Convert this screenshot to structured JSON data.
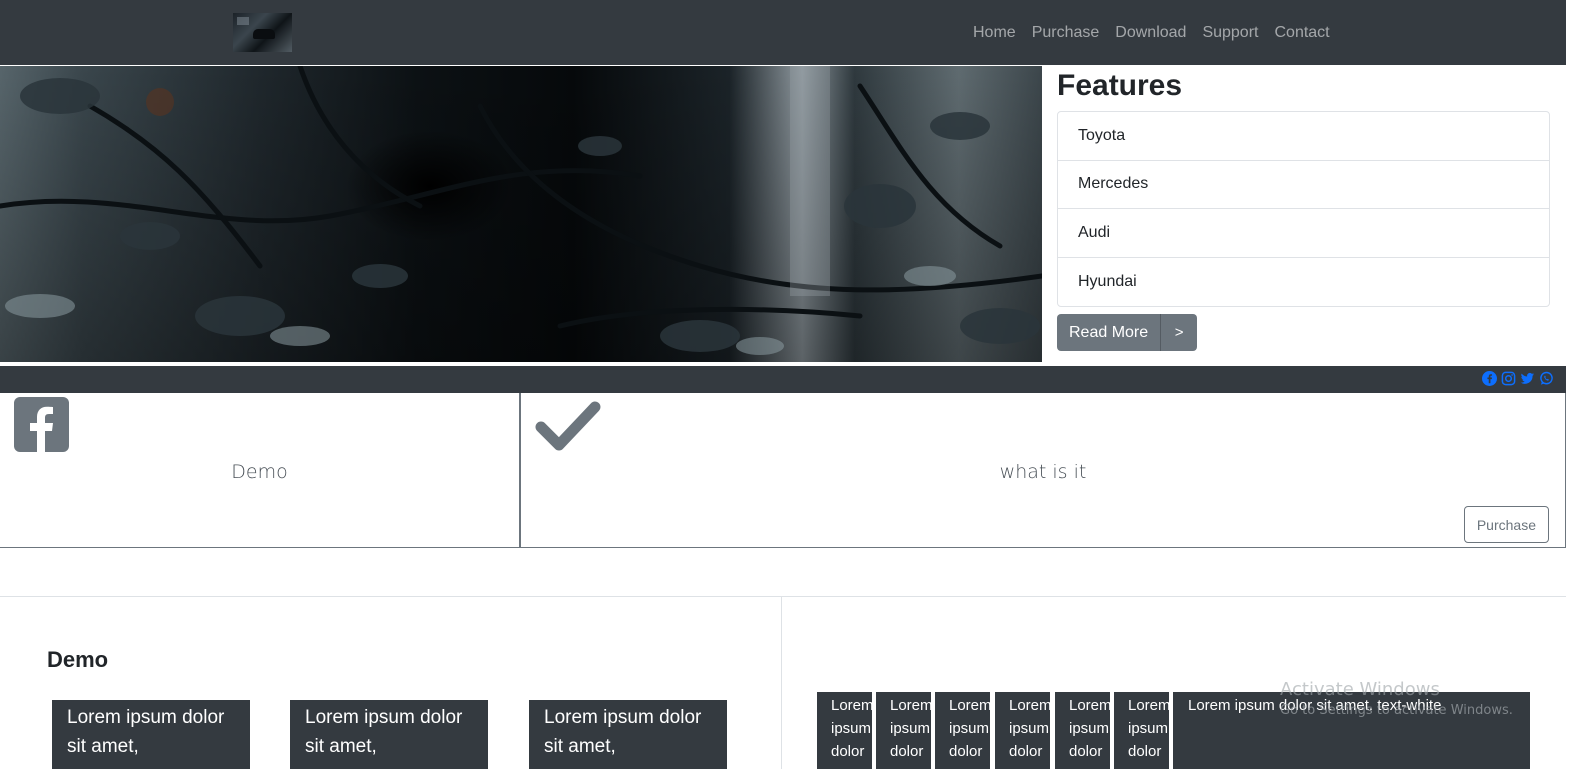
{
  "navbar": {
    "links": [
      "Home",
      "Purchase",
      "Download",
      "Support",
      "Contact"
    ]
  },
  "features": {
    "title": "Features",
    "items": [
      "Toyota",
      "Mercedes",
      "Audi",
      "Hyundai"
    ],
    "read_more_label": "Read More",
    "next_label": ">"
  },
  "social": {
    "icons": [
      "facebook-icon",
      "instagram-icon",
      "twitter-icon",
      "whatsapp-icon"
    ],
    "color": "#0d6efd"
  },
  "cards": {
    "left_text": "Demo",
    "right_text": "what is it",
    "purchase_label": "Purchase"
  },
  "demo": {
    "heading": "Demo",
    "cards": [
      "Lorem ipsum dolor sit amet,",
      "Lorem ipsum dolor sit amet,",
      "Lorem ipsum dolor sit amet,"
    ]
  },
  "columns": {
    "narrow": [
      "Lorem ipsum dolor",
      "Lorem ipsum dolor",
      "Lorem ipsum dolor",
      "Lorem ipsum dolor",
      "Lorem ipsum dolor",
      "Lorem ipsum dolor"
    ],
    "wide": "Lorem ipsum dolor sit amet. text-white"
  },
  "watermark": {
    "title": "Activate Windows",
    "subtitle": "Go to Settings to activate Windows."
  },
  "colors": {
    "dark": "#343a40",
    "secondary": "#6c757d"
  }
}
